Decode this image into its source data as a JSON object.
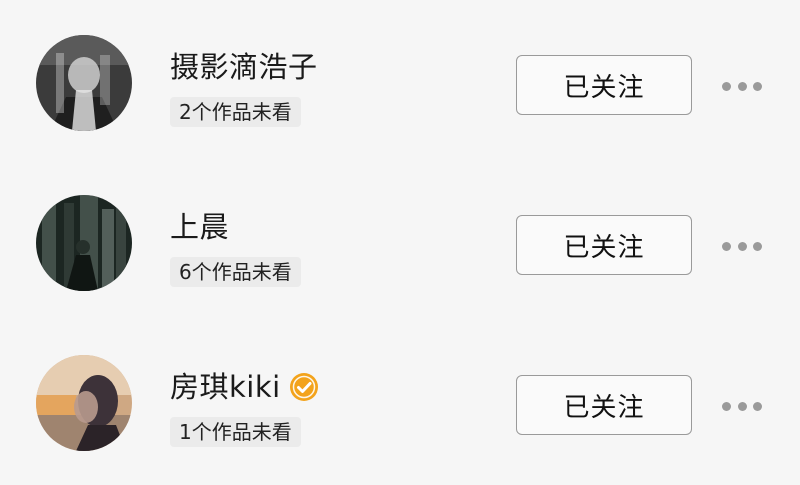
{
  "follow_list": [
    {
      "name": "摄影滴浩子",
      "verified": false,
      "unseen_works": "2个作品未看",
      "follow_label": "已关注",
      "avatar_colors": [
        "#2c2c2c",
        "#bdbdbd"
      ]
    },
    {
      "name": "上晨",
      "verified": false,
      "unseen_works": "6个作品未看",
      "follow_label": "已关注",
      "avatar_colors": [
        "#16201c",
        "#7f8c86"
      ]
    },
    {
      "name": "房琪kiki",
      "verified": true,
      "unseen_works": "1个作品未看",
      "follow_label": "已关注",
      "avatar_colors": [
        "#d9b18a",
        "#3a2f35"
      ]
    }
  ],
  "icons": {
    "more": "more-dots-icon",
    "verified": "verified-badge-icon"
  },
  "colors": {
    "background": "#f6f6f6",
    "verified_badge": "#f3a31b",
    "button_border": "#9a9a9a",
    "tag_background": "#ebebeb"
  }
}
